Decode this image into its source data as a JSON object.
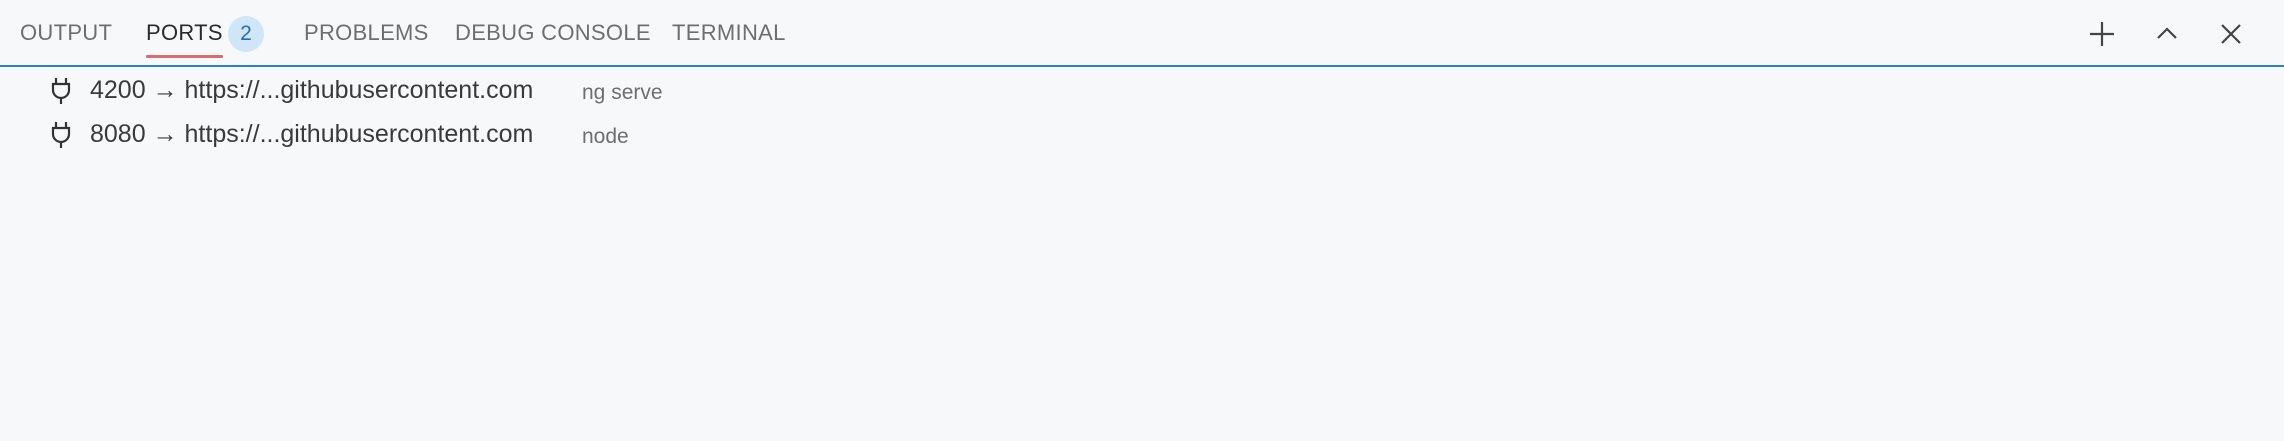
{
  "tabs": [
    {
      "label": "OUTPUT"
    },
    {
      "label": "PORTS",
      "badge": "2"
    },
    {
      "label": "PROBLEMS"
    },
    {
      "label": "DEBUG CONSOLE"
    },
    {
      "label": "TERMINAL"
    }
  ],
  "active_tab": "PORTS",
  "actions": {
    "add_icon": "plus-icon",
    "maximize_icon": "chevron-up-icon",
    "close_icon": "close-icon"
  },
  "ports": [
    {
      "port": "4200",
      "arrow": "→",
      "url": "https://...githubusercontent.com",
      "process": "ng serve"
    },
    {
      "port": "8080",
      "arrow": "→",
      "url": "https://...githubusercontent.com",
      "process": "node"
    }
  ],
  "colors": {
    "background": "#f6f8fa",
    "active_underline": "#d96d6d",
    "focus_border": "#2d7dd2",
    "badge_bg": "#cfe6f9"
  }
}
